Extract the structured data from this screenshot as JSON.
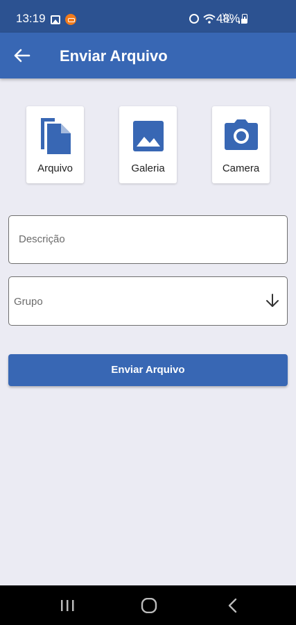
{
  "status_bar": {
    "time": "13:19",
    "volte_label": "Vo) LTE1",
    "battery": "48%"
  },
  "app_bar": {
    "title": "Enviar Arquivo"
  },
  "sources": [
    {
      "label": "Arquivo",
      "icon": "file-copy-icon"
    },
    {
      "label": "Galeria",
      "icon": "image-icon"
    },
    {
      "label": "Camera",
      "icon": "camera-icon"
    }
  ],
  "form": {
    "description_placeholder": "Descrição",
    "group_placeholder": "Grupo",
    "submit_label": "Enviar Arquivo"
  },
  "colors": {
    "status_bar": "#2c5291",
    "primary": "#3867b4",
    "background": "#ebebf3",
    "nav_bar": "#000000"
  }
}
